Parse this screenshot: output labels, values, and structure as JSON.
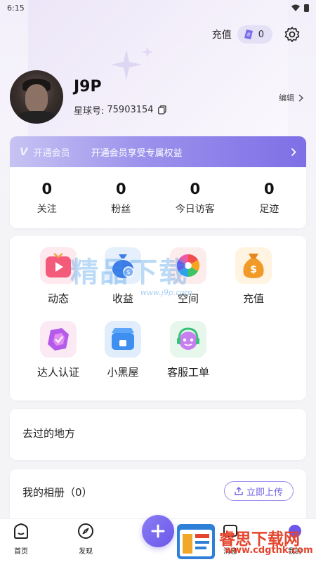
{
  "statusbar": {
    "time": "6:15"
  },
  "header": {
    "recharge_label": "充值",
    "coin_balance": "0",
    "colors": {
      "pill": "#e4e0f6",
      "accent": "#6b58ea"
    }
  },
  "profile": {
    "username": "J9P",
    "star_id_label": "星球号:",
    "star_id": "75903154",
    "edit_label": "编辑"
  },
  "member": {
    "logo": "V",
    "label": "开通会员",
    "desc": "开通会员享受专属权益"
  },
  "stats": [
    {
      "value": "0",
      "label": "关注"
    },
    {
      "value": "0",
      "label": "粉丝"
    },
    {
      "value": "0",
      "label": "今日访客"
    },
    {
      "value": "0",
      "label": "足迹"
    }
  ],
  "grid": [
    {
      "label": "动态",
      "icon": "video-icon"
    },
    {
      "label": "收益",
      "icon": "money-bag-icon"
    },
    {
      "label": "空间",
      "icon": "camera-aperture-icon"
    },
    {
      "label": "充值",
      "icon": "coin-bag-icon"
    },
    {
      "label": "达人认证",
      "icon": "verified-shield-icon"
    },
    {
      "label": "小黑屋",
      "icon": "shop-icon"
    },
    {
      "label": "客服工单",
      "icon": "support-bot-icon"
    }
  ],
  "places": {
    "title": "去过的地方"
  },
  "album": {
    "title": "我的相册（0）",
    "upload_label": "立即上传"
  },
  "watermark": {
    "text": "精品下载",
    "url": "www.j9p.com"
  },
  "corner_watermark": {
    "text": "睿思下载网",
    "url": "www.cdgthk.com"
  },
  "tabbar": [
    {
      "label": "首页",
      "icon": "home-icon"
    },
    {
      "label": "发现",
      "icon": "compass-icon"
    },
    {
      "label": "消息",
      "icon": "message-icon"
    },
    {
      "label": "我的",
      "icon": "profile-icon"
    }
  ]
}
